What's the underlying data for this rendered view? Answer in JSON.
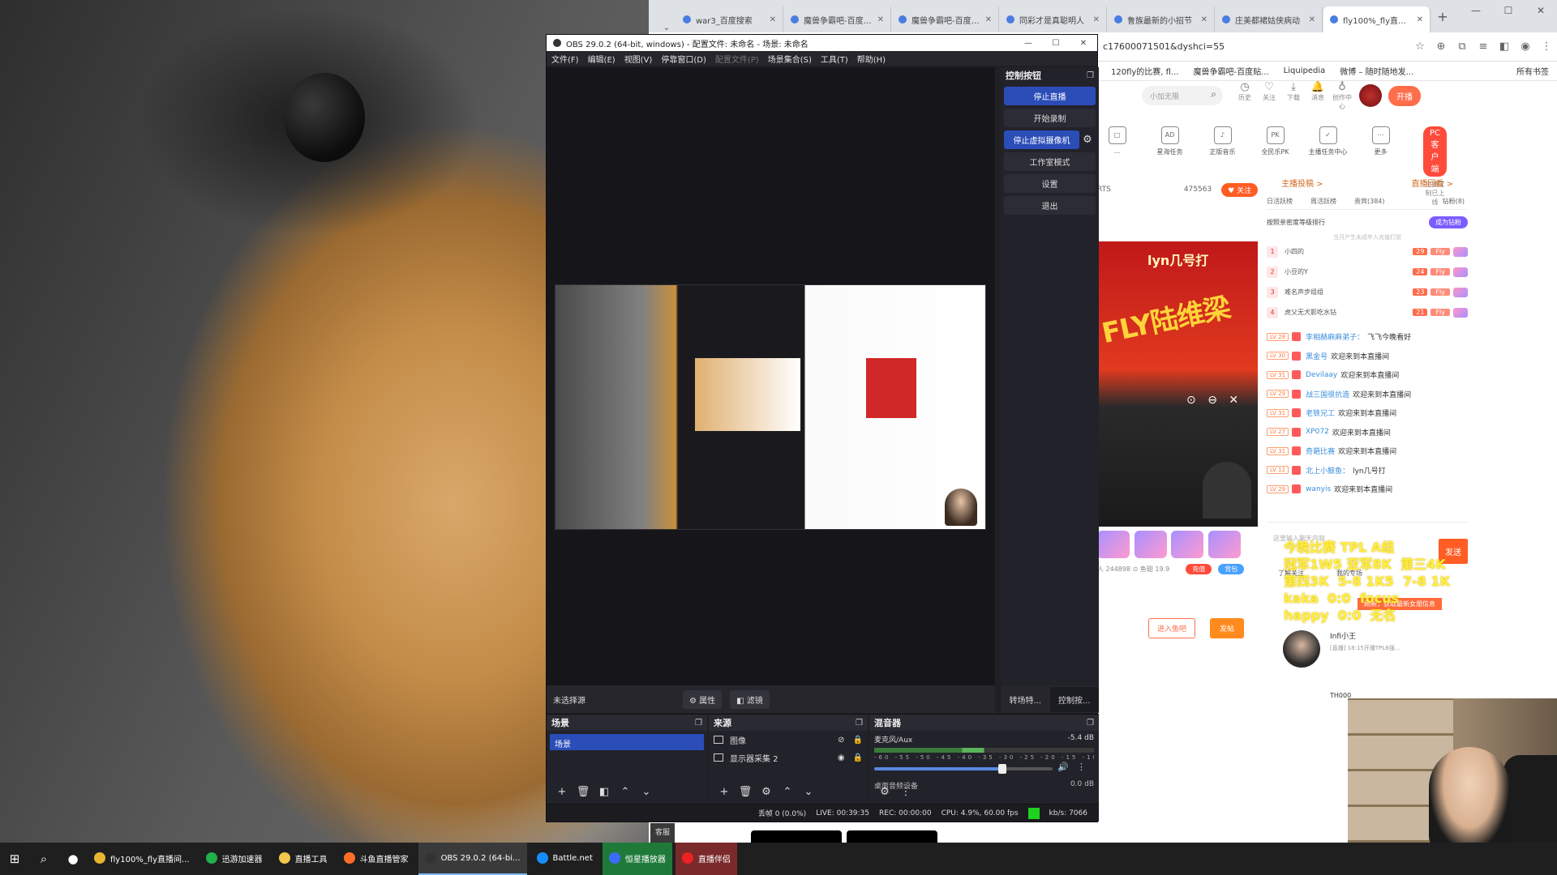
{
  "browser": {
    "tabs": [
      {
        "label": "war3_百度搜索"
      },
      {
        "label": "魔兽争霸吧-百度贴吧"
      },
      {
        "label": "魔兽争霸吧-百度贴吧"
      },
      {
        "label": "同彩才是真聪明人"
      },
      {
        "label": "鲁族最新的小招节"
      },
      {
        "label": "庄美都裙姑侠病动"
      },
      {
        "label": "fly100%_fly直播间",
        "active": true
      }
    ],
    "new_tab": "+",
    "window_controls": [
      "—",
      "☐",
      "✕"
    ],
    "address": "c17600071501&dyshci=55",
    "bookmarks": [
      "120fly的比赛, fl...",
      "魔兽争霸吧-百度贴...",
      "Liquipedia",
      "微博 – 随时随地发...",
      "所有书签"
    ]
  },
  "douyu": {
    "search_placeholder": "小加无限",
    "header_icons": [
      {
        "icon": "history-icon",
        "glyph": "◷",
        "label": "历史"
      },
      {
        "icon": "follow-icon",
        "glyph": "♡",
        "label": "关注"
      },
      {
        "icon": "download-icon",
        "glyph": "⤓",
        "label": "下载"
      },
      {
        "icon": "message-icon",
        "glyph": "🔔",
        "label": "消息"
      },
      {
        "icon": "creator-icon",
        "glyph": "♁",
        "label": "创作中心"
      }
    ],
    "live_button": "开播",
    "tools": [
      {
        "glyph": "□",
        "label": "..."
      },
      {
        "glyph": "AD",
        "label": "星海任务"
      },
      {
        "glyph": "♪",
        "label": "正版音乐"
      },
      {
        "glyph": "PK",
        "label": "全民乐PK"
      },
      {
        "glyph": "✓",
        "label": "主播任务中心"
      },
      {
        "glyph": "⋯",
        "label": "更多"
      }
    ],
    "pc_client": "PC客户端",
    "pc_client_sub": "主播定制已上线",
    "follow_prefix": "RTS",
    "follow_count": "475563",
    "follow_button": "♥ 关注",
    "video_title": "lyn几号打",
    "video_fly": "FLY陆维梁",
    "video_ctrls": [
      "⊙",
      "⊖",
      "✕"
    ],
    "gift_stats": "人 244898  ⊙ 鱼翅 19.9",
    "recharge": "充值",
    "bag": "背包",
    "fan_group": "进入鱼吧",
    "post_button": "发帖",
    "right_tabs": [
      "主播投稿 >",
      "直播回看 >"
    ],
    "rank_tabs": [
      "日活跃榜",
      "周活跃榜",
      "贵宾(384)",
      "钻粉(8)"
    ],
    "rank_head": "按照亲密度等级排行",
    "join_fans": "成为钻粉",
    "rank_note": "当月产生未成年人充值打赏",
    "rank": [
      {
        "n": "1",
        "name": "小四的",
        "lv": "29"
      },
      {
        "n": "2",
        "name": "小豆的Y",
        "lv": "24"
      },
      {
        "n": "3",
        "name": "难名声步组组",
        "lv": "23"
      },
      {
        "n": "4",
        "name": "虎父无犬影吃水钻",
        "lv": "21"
      }
    ],
    "fly_label": "Fly",
    "chat": [
      {
        "lv": "LV 28",
        "name": "李相赫麻麻弟子：",
        "msg": "飞飞今晚看好"
      },
      {
        "lv": "LV 30",
        "name": "黑金号",
        "msg": "欢迎来到本直播间"
      },
      {
        "lv": "LV 31",
        "name": "Devilaay",
        "msg": "欢迎来到本直播间"
      },
      {
        "lv": "LV 29",
        "name": "战三国很抗造",
        "msg": "欢迎来到本直播间"
      },
      {
        "lv": "LV 31",
        "name": "老铁兄工",
        "msg": "欢迎来到本直播间"
      },
      {
        "lv": "LV 27",
        "name": "XP072",
        "msg": "欢迎来到本直播间"
      },
      {
        "lv": "LV 31",
        "name": "奇葩比赛",
        "msg": "欢迎来到本直播间"
      },
      {
        "lv": "LV 12",
        "name": "北上小鲸鱼：",
        "msg": "lyn几号打"
      },
      {
        "lv": "LV 29",
        "name": "wanyis",
        "msg": "欢迎来到本直播间"
      }
    ],
    "chat_input_placeholder": "这里输入聊天内容",
    "send": "发送",
    "friends_tabs": [
      "了解关注",
      "我的专场"
    ],
    "refresh_tip": "刷新，获取最新女朋信息",
    "streamer_name": "Infi小王",
    "streamer_sub": "[直播] 18:15开播TPL8强...",
    "streamer_next": "TH000"
  },
  "overlay_lines": [
    "今晚比赛 TPL A组",
    "冠军1W5 亚军8K  第三4K",
    "第四3K  5-8 1K5  7-8 1K",
    "kaka  0:0  focus",
    "happy  0:0  无名"
  ],
  "obs": {
    "title": "OBS 29.0.2 (64-bit, windows) - 配置文件: 未命名 - 场景: 未命名",
    "window_controls": [
      "—",
      "☐",
      "✕"
    ],
    "menu": [
      {
        "label": "文件(F)"
      },
      {
        "label": "编辑(E)"
      },
      {
        "label": "视图(V)"
      },
      {
        "label": "停靠窗口(D)"
      },
      {
        "label": "配置文件(P)",
        "dim": true
      },
      {
        "label": "场景集合(S)"
      },
      {
        "label": "工具(T)"
      },
      {
        "label": "帮助(H)"
      }
    ],
    "controls_header": "控制按钮",
    "controls": {
      "stop_stream": "停止直播",
      "start_record": "开始录制",
      "stop_vcam": "停止虚拟摄像机",
      "studio_mode": "工作室模式",
      "settings": "设置",
      "exit": "退出"
    },
    "no_source": "未选择源",
    "properties": "⚙ 属性",
    "filters": "◧ 滤镜",
    "transitions_tab": "转场特...",
    "controls_tab": "控制按...",
    "scenes_header": "场景",
    "scene_item": "场景",
    "sources_header": "来源",
    "sources": [
      {
        "name": "图像",
        "eye": "⊘",
        "lock": "🔒"
      },
      {
        "name": "显示器采集 2",
        "eye": "◉",
        "lock": "🔒"
      }
    ],
    "mixer_header": "混音器",
    "mixer_channel": "麦克风/Aux",
    "mixer_db": "-5.4 dB",
    "mixer_scale": "-60 -55 -50 -45 -40 -35 -30 -25 -20 -15 -10 -5 0",
    "mixer_volume": 0.72,
    "mixer_channel2": "桌面音频设备",
    "mixer_db2": "0.0 dB",
    "status": {
      "dropped": "丢帧 0 (0.0%)",
      "live": "LIVE: 00:39:35",
      "rec": "REC: 00:00:00",
      "cpu": "CPU: 4.9%, 60.00 fps",
      "kbps": "kb/s: 7066"
    }
  },
  "helper_tab": "客服",
  "taskbar": {
    "apps": [
      {
        "label": "fly100%_fly直播间...",
        "color": "#e9b531"
      },
      {
        "label": "迅游加速器",
        "color": "#21b04b"
      },
      {
        "label": "直播工具",
        "color": "#f2c94c"
      },
      {
        "label": "斗鱼直播管家",
        "color": "#ff6e28"
      },
      {
        "label": "OBS 29.0.2 (64-bi...",
        "color": "#333",
        "active": true
      },
      {
        "label": "Battle.net",
        "color": "#148eff"
      },
      {
        "label": "恒星播放器",
        "color": "#3b6cff",
        "highlight": true
      },
      {
        "label": "直播伴侣",
        "color": "#e22",
        "highlight": true
      }
    ]
  }
}
